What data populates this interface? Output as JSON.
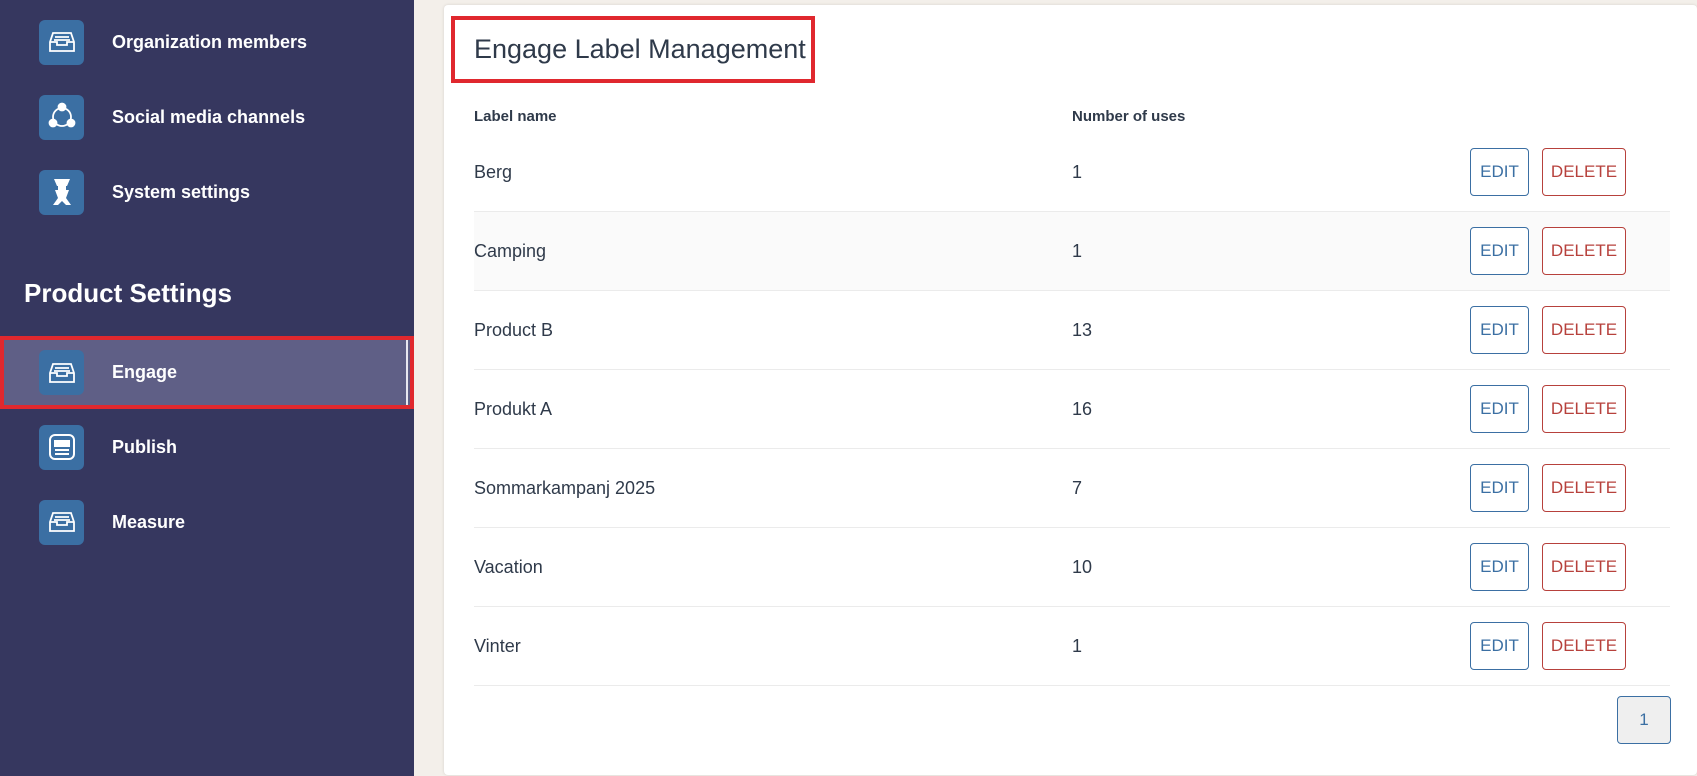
{
  "sidebar": {
    "items_top": [
      {
        "label": "Organization members",
        "icon": "inbox-tray-icon"
      },
      {
        "label": "Social media channels",
        "icon": "share-nodes-icon"
      },
      {
        "label": "System settings",
        "icon": "robot-icon"
      }
    ],
    "section_title": "Product Settings",
    "items_product": [
      {
        "label": "Engage",
        "icon": "inbox-tray-icon",
        "active": true
      },
      {
        "label": "Publish",
        "icon": "document-list-icon"
      },
      {
        "label": "Measure",
        "icon": "inbox-tray-icon"
      }
    ]
  },
  "main": {
    "title": "Engage Label Management",
    "columns": {
      "name": "Label name",
      "uses": "Number of uses"
    },
    "rows": [
      {
        "name": "Berg",
        "uses": "1"
      },
      {
        "name": "Camping",
        "uses": "1"
      },
      {
        "name": "Product B",
        "uses": "13"
      },
      {
        "name": "Produkt A",
        "uses": "16"
      },
      {
        "name": "Sommarkampanj 2025",
        "uses": "7"
      },
      {
        "name": "Vacation",
        "uses": "10"
      },
      {
        "name": "Vinter",
        "uses": "1"
      }
    ],
    "edit_label": "EDIT",
    "delete_label": "DELETE",
    "pagination": {
      "current_page": "1"
    }
  },
  "colors": {
    "sidebar_bg": "#36375f",
    "active_item_bg": "#5f5f86",
    "highlight_red": "#e0282e",
    "accent_blue": "#3b6fa3",
    "delete_red": "#b7413c"
  }
}
